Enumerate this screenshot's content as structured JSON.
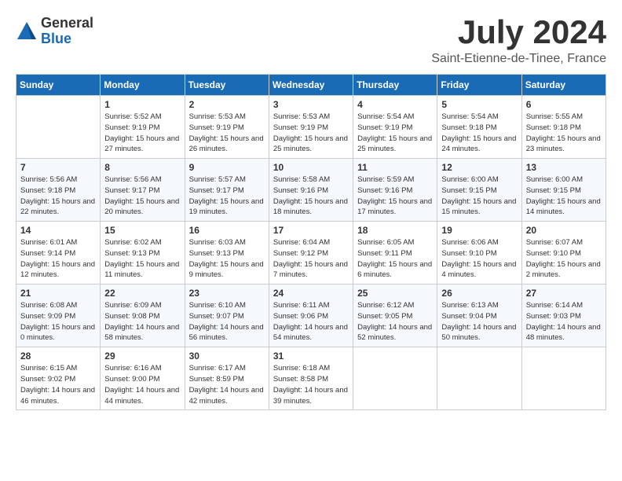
{
  "logo": {
    "general": "General",
    "blue": "Blue"
  },
  "title": "July 2024",
  "location": "Saint-Etienne-de-Tinee, France",
  "days_header": [
    "Sunday",
    "Monday",
    "Tuesday",
    "Wednesday",
    "Thursday",
    "Friday",
    "Saturday"
  ],
  "weeks": [
    [
      {
        "day": "",
        "sunrise": "",
        "sunset": "",
        "daylight": ""
      },
      {
        "day": "1",
        "sunrise": "5:52 AM",
        "sunset": "9:19 PM",
        "daylight": "15 hours and 27 minutes."
      },
      {
        "day": "2",
        "sunrise": "5:53 AM",
        "sunset": "9:19 PM",
        "daylight": "15 hours and 26 minutes."
      },
      {
        "day": "3",
        "sunrise": "5:53 AM",
        "sunset": "9:19 PM",
        "daylight": "15 hours and 25 minutes."
      },
      {
        "day": "4",
        "sunrise": "5:54 AM",
        "sunset": "9:19 PM",
        "daylight": "15 hours and 25 minutes."
      },
      {
        "day": "5",
        "sunrise": "5:54 AM",
        "sunset": "9:18 PM",
        "daylight": "15 hours and 24 minutes."
      },
      {
        "day": "6",
        "sunrise": "5:55 AM",
        "sunset": "9:18 PM",
        "daylight": "15 hours and 23 minutes."
      }
    ],
    [
      {
        "day": "7",
        "sunrise": "5:56 AM",
        "sunset": "9:18 PM",
        "daylight": "15 hours and 22 minutes."
      },
      {
        "day": "8",
        "sunrise": "5:56 AM",
        "sunset": "9:17 PM",
        "daylight": "15 hours and 20 minutes."
      },
      {
        "day": "9",
        "sunrise": "5:57 AM",
        "sunset": "9:17 PM",
        "daylight": "15 hours and 19 minutes."
      },
      {
        "day": "10",
        "sunrise": "5:58 AM",
        "sunset": "9:16 PM",
        "daylight": "15 hours and 18 minutes."
      },
      {
        "day": "11",
        "sunrise": "5:59 AM",
        "sunset": "9:16 PM",
        "daylight": "15 hours and 17 minutes."
      },
      {
        "day": "12",
        "sunrise": "6:00 AM",
        "sunset": "9:15 PM",
        "daylight": "15 hours and 15 minutes."
      },
      {
        "day": "13",
        "sunrise": "6:00 AM",
        "sunset": "9:15 PM",
        "daylight": "15 hours and 14 minutes."
      }
    ],
    [
      {
        "day": "14",
        "sunrise": "6:01 AM",
        "sunset": "9:14 PM",
        "daylight": "15 hours and 12 minutes."
      },
      {
        "day": "15",
        "sunrise": "6:02 AM",
        "sunset": "9:13 PM",
        "daylight": "15 hours and 11 minutes."
      },
      {
        "day": "16",
        "sunrise": "6:03 AM",
        "sunset": "9:13 PM",
        "daylight": "15 hours and 9 minutes."
      },
      {
        "day": "17",
        "sunrise": "6:04 AM",
        "sunset": "9:12 PM",
        "daylight": "15 hours and 7 minutes."
      },
      {
        "day": "18",
        "sunrise": "6:05 AM",
        "sunset": "9:11 PM",
        "daylight": "15 hours and 6 minutes."
      },
      {
        "day": "19",
        "sunrise": "6:06 AM",
        "sunset": "9:10 PM",
        "daylight": "15 hours and 4 minutes."
      },
      {
        "day": "20",
        "sunrise": "6:07 AM",
        "sunset": "9:10 PM",
        "daylight": "15 hours and 2 minutes."
      }
    ],
    [
      {
        "day": "21",
        "sunrise": "6:08 AM",
        "sunset": "9:09 PM",
        "daylight": "15 hours and 0 minutes."
      },
      {
        "day": "22",
        "sunrise": "6:09 AM",
        "sunset": "9:08 PM",
        "daylight": "14 hours and 58 minutes."
      },
      {
        "day": "23",
        "sunrise": "6:10 AM",
        "sunset": "9:07 PM",
        "daylight": "14 hours and 56 minutes."
      },
      {
        "day": "24",
        "sunrise": "6:11 AM",
        "sunset": "9:06 PM",
        "daylight": "14 hours and 54 minutes."
      },
      {
        "day": "25",
        "sunrise": "6:12 AM",
        "sunset": "9:05 PM",
        "daylight": "14 hours and 52 minutes."
      },
      {
        "day": "26",
        "sunrise": "6:13 AM",
        "sunset": "9:04 PM",
        "daylight": "14 hours and 50 minutes."
      },
      {
        "day": "27",
        "sunrise": "6:14 AM",
        "sunset": "9:03 PM",
        "daylight": "14 hours and 48 minutes."
      }
    ],
    [
      {
        "day": "28",
        "sunrise": "6:15 AM",
        "sunset": "9:02 PM",
        "daylight": "14 hours and 46 minutes."
      },
      {
        "day": "29",
        "sunrise": "6:16 AM",
        "sunset": "9:00 PM",
        "daylight": "14 hours and 44 minutes."
      },
      {
        "day": "30",
        "sunrise": "6:17 AM",
        "sunset": "8:59 PM",
        "daylight": "14 hours and 42 minutes."
      },
      {
        "day": "31",
        "sunrise": "6:18 AM",
        "sunset": "8:58 PM",
        "daylight": "14 hours and 39 minutes."
      },
      {
        "day": "",
        "sunrise": "",
        "sunset": "",
        "daylight": ""
      },
      {
        "day": "",
        "sunrise": "",
        "sunset": "",
        "daylight": ""
      },
      {
        "day": "",
        "sunrise": "",
        "sunset": "",
        "daylight": ""
      }
    ]
  ]
}
